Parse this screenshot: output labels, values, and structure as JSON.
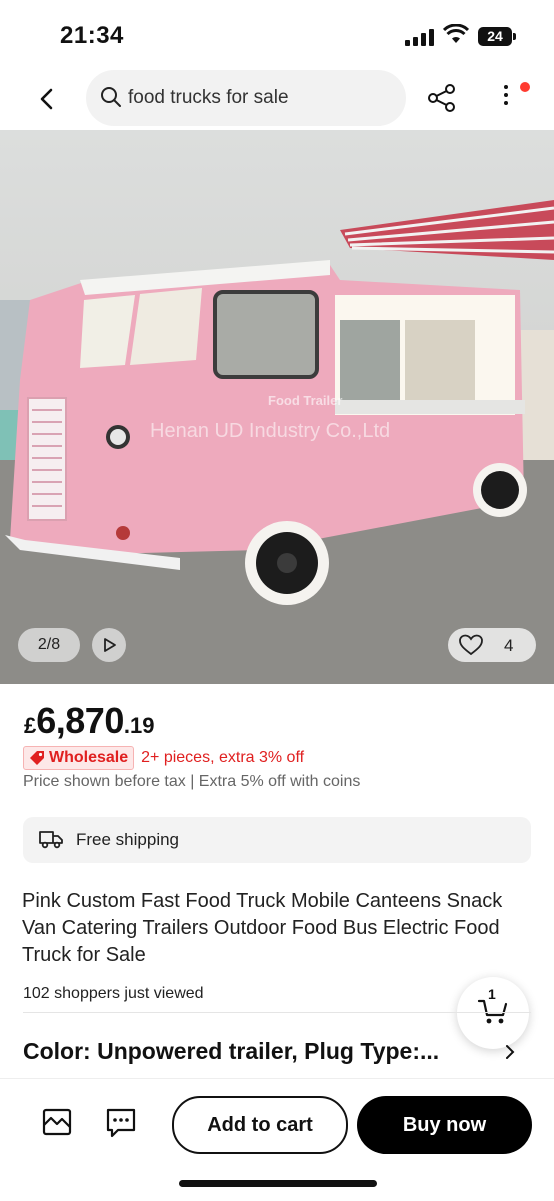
{
  "status_bar": {
    "time": "21:34",
    "battery": "24"
  },
  "search": {
    "query": "food trucks for sale"
  },
  "gallery": {
    "counter": "2/8",
    "favorites_count": "4",
    "watermark_brand": "Food Trailer",
    "watermark_company": "Henan UD Industry Co.,Ltd"
  },
  "price": {
    "currency": "£",
    "main": "6,870",
    "cents": ".19"
  },
  "promo": {
    "badge": "Wholesale",
    "text": "2+ pieces, extra 3% off"
  },
  "tax_note": "Price shown before tax | Extra 5% off with coins",
  "shipping": {
    "label": "Free shipping"
  },
  "product": {
    "title": "Pink Custom Fast Food Truck Mobile Canteens Snack Van Catering Trailers Outdoor Food Bus Electric Food Truck for Sale",
    "viewers": "102 shoppers just viewed",
    "variant": "Color: Unpowered trailer, Plug Type:..."
  },
  "cart": {
    "count": "1"
  },
  "bottom": {
    "add_to_cart": "Add to cart",
    "buy_now": "Buy now"
  },
  "colors": {
    "accent_red": "#e02020",
    "truck_pink": "#eeaabd",
    "button_black": "#000000"
  },
  "icons": [
    "back-icon",
    "search-icon",
    "share-icon",
    "more-icon",
    "play-icon",
    "heart-icon",
    "tag-icon",
    "truck-icon",
    "cart-icon",
    "chevron-right-icon",
    "store-icon",
    "chat-icon"
  ]
}
